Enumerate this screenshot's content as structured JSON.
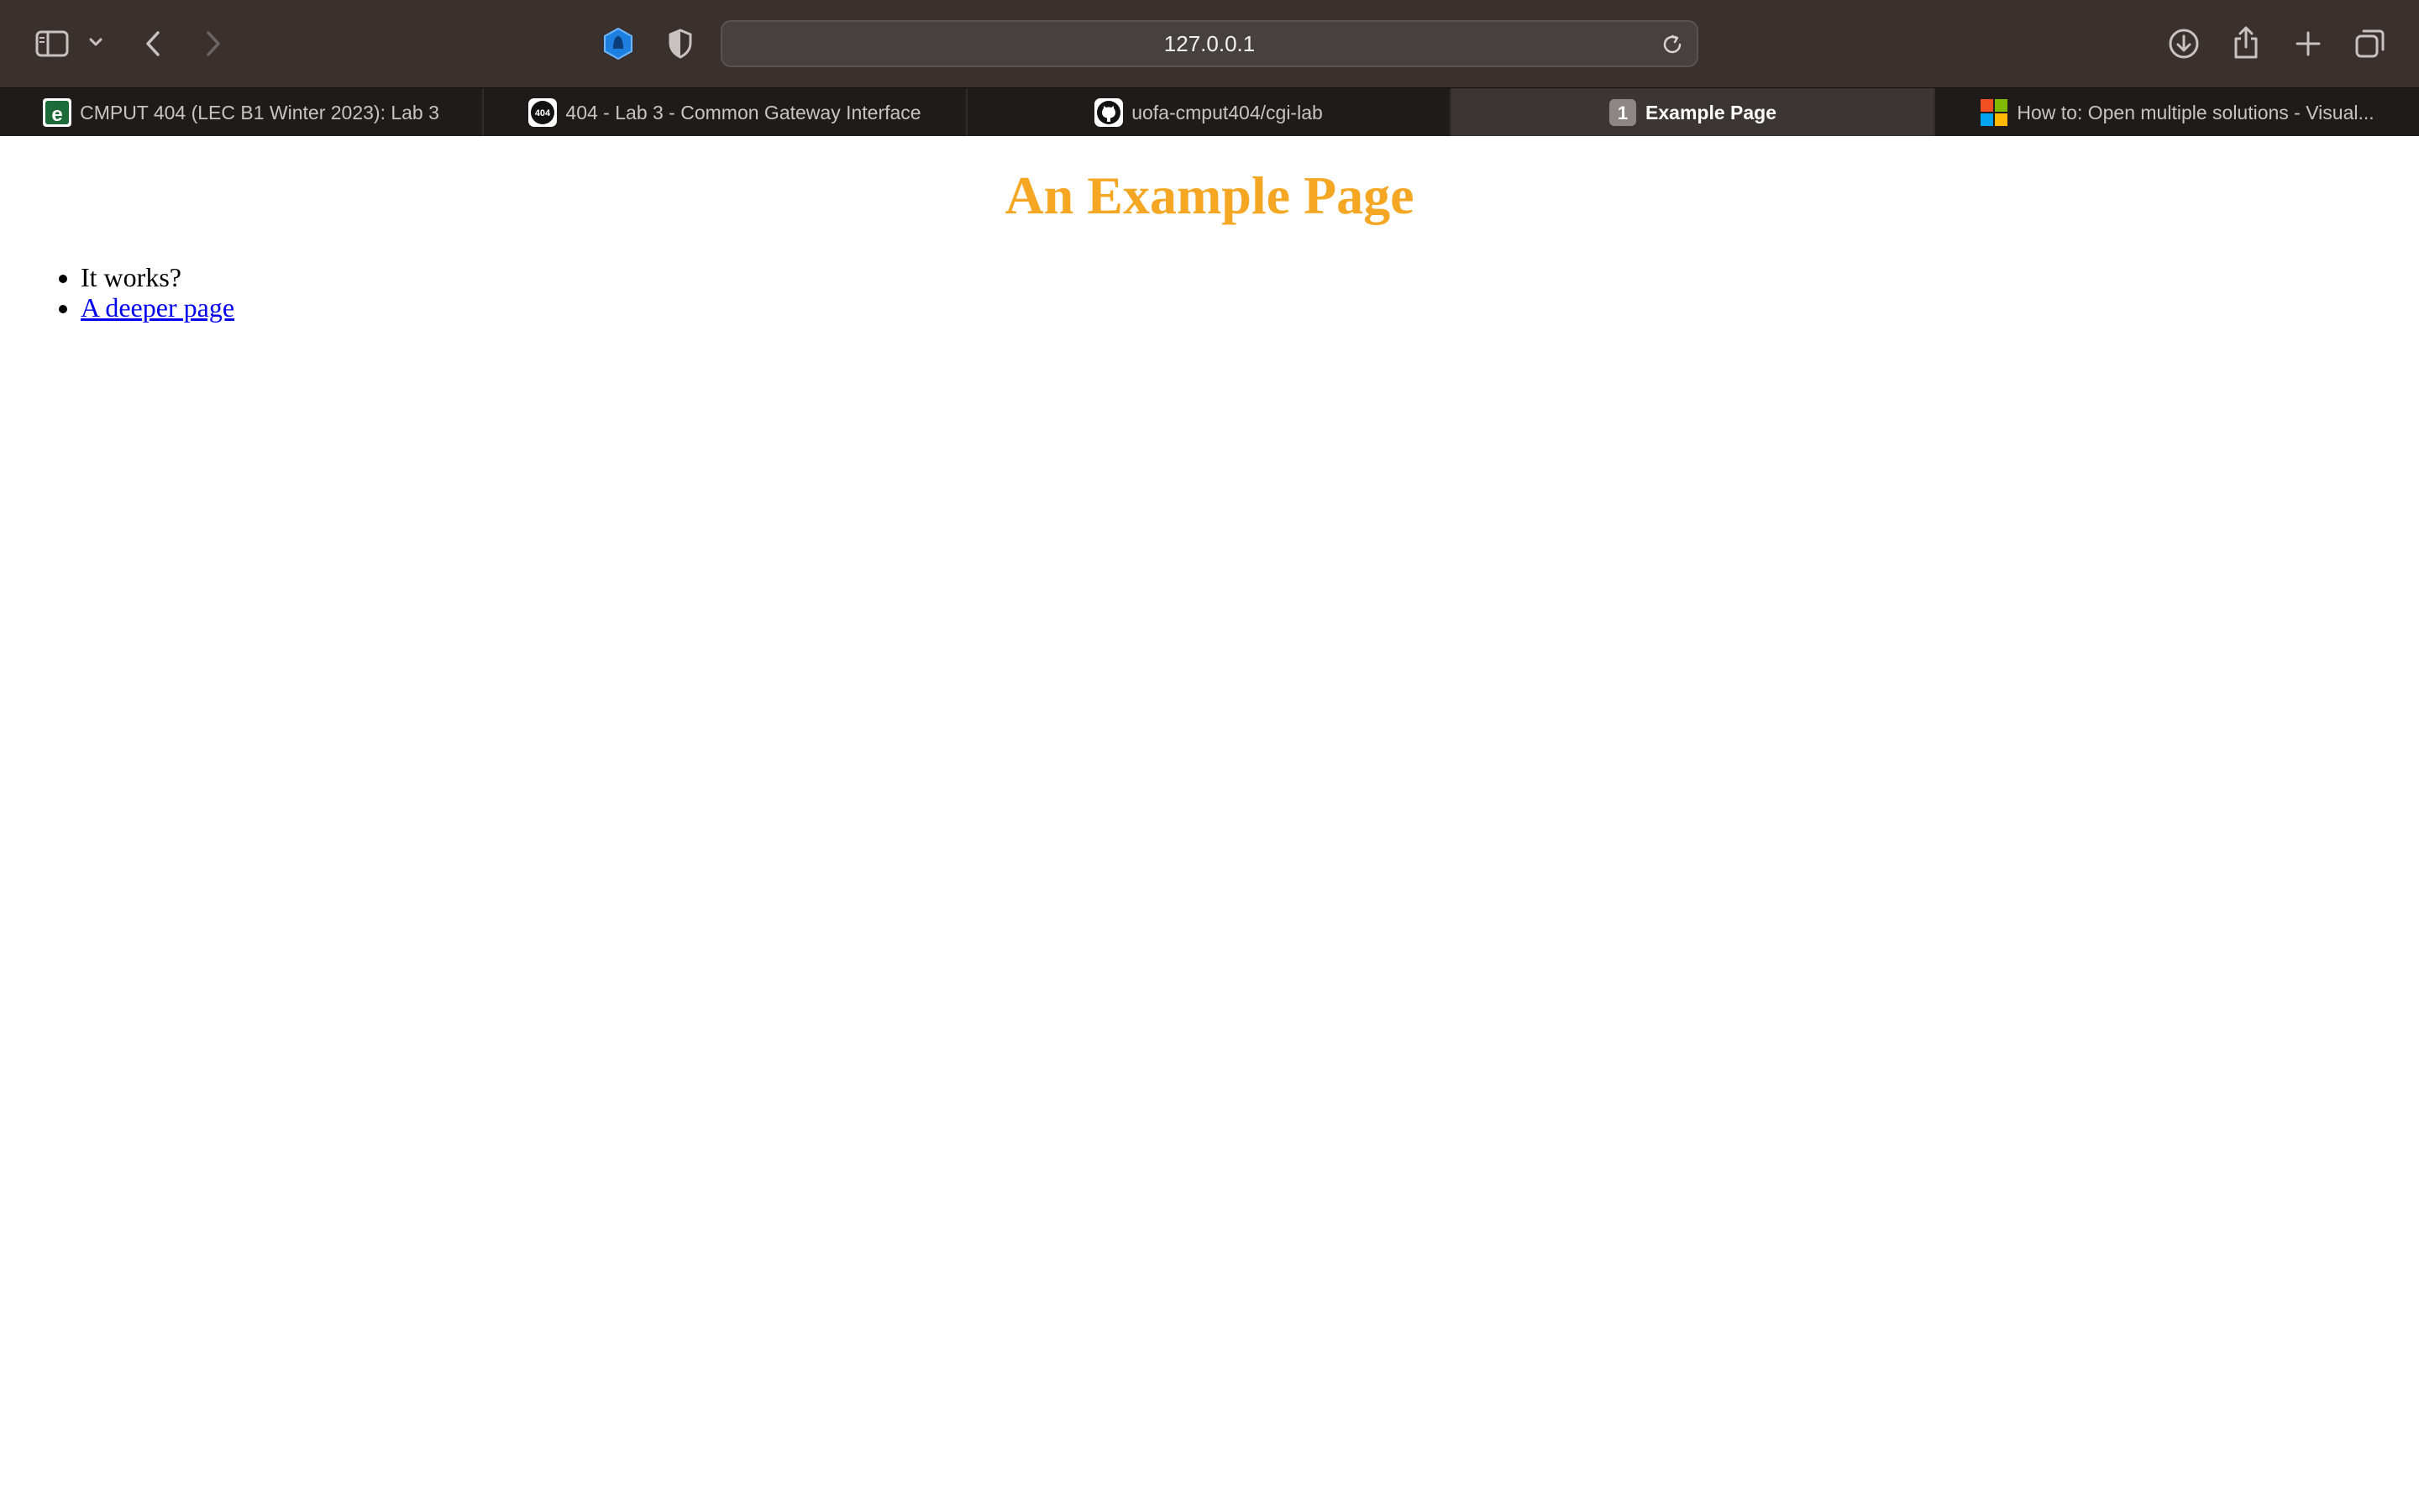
{
  "browser": {
    "url": "127.0.0.1",
    "tabs": [
      {
        "label": "CMPUT 404 (LEC B1 Winter 2023): Lab 3",
        "icon": "eclass-icon",
        "active": false
      },
      {
        "label": "404 - Lab 3 - Common Gateway Interface",
        "icon": "404-icon",
        "active": false
      },
      {
        "label": "uofa-cmput404/cgi-lab",
        "icon": "github-icon",
        "active": false
      },
      {
        "label": "Example Page",
        "icon": "tab-count-badge",
        "badge": "1",
        "active": true
      },
      {
        "label": "How to: Open multiple solutions - Visual...",
        "icon": "microsoft-icon",
        "active": false
      }
    ],
    "toolbar_icons": [
      "sidebar-icon",
      "chevron-down-icon",
      "back-icon",
      "forward-icon",
      "privacy-icon",
      "shield-icon",
      "reload-icon",
      "download-icon",
      "share-icon",
      "new-tab-icon",
      "tab-overview-icon"
    ]
  },
  "page": {
    "heading": "An Example Page",
    "heading_color": "#f5a623",
    "items": [
      {
        "text": "It works?"
      },
      {
        "text": "A deeper page",
        "link": true
      }
    ]
  },
  "colors": {
    "toolbar_bg": "#3a302e",
    "tabbar_bg": "#1f1b1b",
    "active_tab_bg": "#3c3535",
    "link": "#0000ee"
  }
}
